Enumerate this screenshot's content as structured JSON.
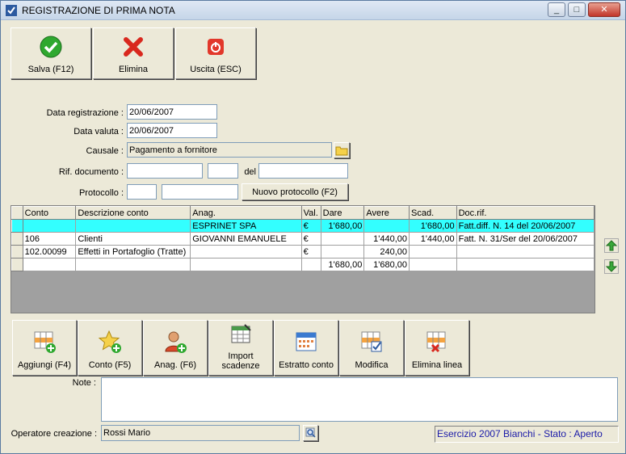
{
  "window": {
    "title": "REGISTRAZIONE DI PRIMA NOTA",
    "min": "_",
    "max": "□",
    "close": "✕"
  },
  "toolbar": {
    "save_label": "Salva (F12)",
    "delete_label": "Elimina",
    "exit_label": "Uscita (ESC)"
  },
  "form": {
    "data_registrazione_label": "Data registrazione :",
    "data_registrazione_value": "20/06/2007",
    "data_valuta_label": "Data valuta :",
    "data_valuta_value": "20/06/2007",
    "causale_label": "Causale :",
    "causale_value": "Pagamento a fornitore",
    "rif_documento_label": "Rif. documento :",
    "del_label": "del",
    "protocollo_label": "Protocollo :",
    "nuovo_protocollo_label": "Nuovo protocollo (F2)"
  },
  "grid": {
    "columns": [
      "Conto",
      "Descrizione conto",
      "Anag.",
      "Val.",
      "Dare",
      "Avere",
      "Scad.",
      "Doc.rif."
    ],
    "rows": [
      [
        "",
        "",
        "ESPRINET SPA",
        "€",
        "1'680,00",
        "",
        "1'680,00",
        "Fatt.diff. N. 14 del 20/06/2007"
      ],
      [
        "106",
        "Clienti",
        "GIOVANNI EMANUELE",
        "€",
        "",
        "1'440,00",
        "1'440,00",
        "Fatt. N. 31/Ser del 20/06/2007"
      ],
      [
        "102.00099",
        "Effetti in Portafoglio (Tratte)",
        "",
        "€",
        "",
        "240,00",
        "",
        ""
      ],
      [
        "",
        "",
        "",
        "",
        "1'680,00",
        "1'680,00",
        "",
        ""
      ]
    ]
  },
  "actions": {
    "aggiungi": "Aggiungi (F4)",
    "conto": "Conto (F5)",
    "anag": "Anag. (F6)",
    "import_line1": "Import",
    "import_line2": "scadenze",
    "estratto": "Estratto conto",
    "modifica": "Modifica",
    "elimina_linea": "Elimina linea"
  },
  "note": {
    "label": "Note :",
    "value": ""
  },
  "operatore": {
    "label": "Operatore creazione :",
    "value": "Rossi Mario"
  },
  "status": {
    "text": "Esercizio 2007 Bianchi - Stato : Aperto"
  },
  "colors": {
    "selected_row": "#33ffff",
    "status_text": "#1a1aa8"
  }
}
